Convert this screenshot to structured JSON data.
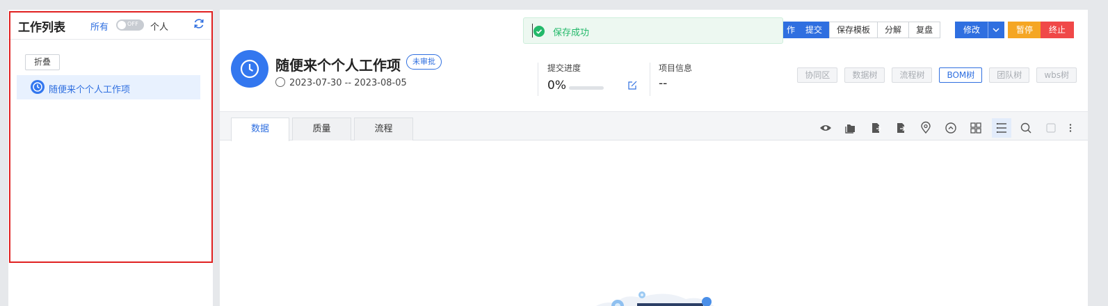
{
  "sidebar": {
    "title": "工作列表",
    "filter_all": "所有",
    "toggle_text": "OFF",
    "filter_personal": "个人",
    "fold_label": "折叠",
    "tree_items": [
      {
        "label": "随便来个个人工作项"
      }
    ]
  },
  "toast": {
    "message": "保存成功"
  },
  "item": {
    "title": "随便来个个人工作项",
    "status": "未审批",
    "date_range": "2023-07-30 -- 2023-08-05"
  },
  "progress": {
    "label": "提交进度",
    "value": "0%",
    "fraction": 0
  },
  "project_info": {
    "label": "项目信息",
    "value": "--"
  },
  "action_buttons": {
    "partial": "作",
    "submit": "提交",
    "save_template": "保存模板",
    "split": "分解",
    "review": "复盘",
    "modify": "修改",
    "pause": "暂停",
    "terminate": "终止"
  },
  "tree_buttons": [
    {
      "label": "协同区",
      "active": false
    },
    {
      "label": "数据树",
      "active": false
    },
    {
      "label": "流程树",
      "active": false
    },
    {
      "label": "BOM树",
      "active": true
    },
    {
      "label": "团队树",
      "active": false
    },
    {
      "label": "wbs树",
      "active": false
    }
  ],
  "tabs": [
    {
      "label": "数据",
      "active": true
    },
    {
      "label": "质量",
      "active": false
    },
    {
      "label": "流程",
      "active": false
    }
  ],
  "toolbar_icons": [
    "eye-icon",
    "folder-settings-icon",
    "file-import-icon",
    "file-export-icon",
    "location-pin-icon",
    "collapse-up-icon",
    "grid-view-icon",
    "list-view-icon",
    "search-icon",
    "checkbox-icon",
    "more-vertical-icon"
  ],
  "colors": {
    "primary": "#2f6fe0",
    "success": "#23b96a",
    "warning": "#f5a623",
    "danger": "#f04848",
    "highlight_border": "#e02020"
  }
}
